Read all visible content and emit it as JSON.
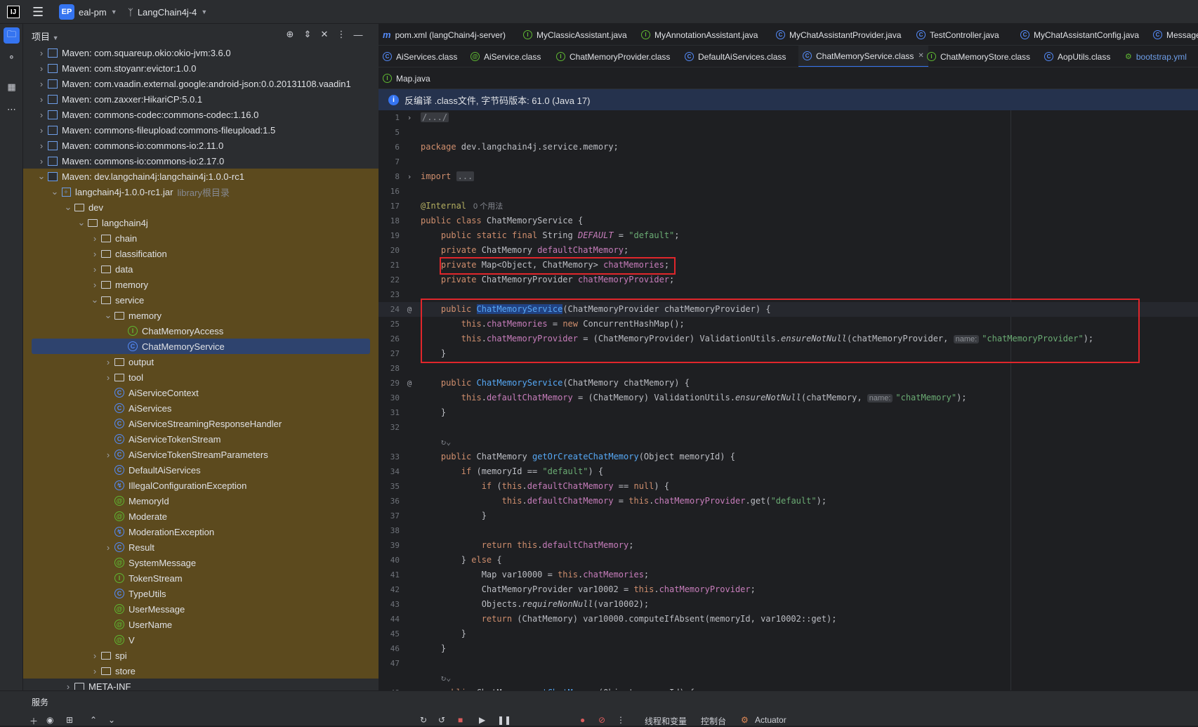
{
  "titlebar": {
    "app_logo": "IJ",
    "project_badge": "EP",
    "project_name": "eal-pm",
    "branch_name": "LangChain4j-4"
  },
  "project_panel": {
    "title": "项目",
    "rows": [
      {
        "label": "Maven: com.squareup.okio:okio-jvm:3.6.0",
        "depth": 1,
        "icon": "lib",
        "open": false
      },
      {
        "label": "Maven: com.stoyanr:evictor:1.0.0",
        "depth": 1,
        "icon": "lib",
        "open": false
      },
      {
        "label": "Maven: com.vaadin.external.google:android-json:0.0.20131108.vaadin1",
        "depth": 1,
        "icon": "lib",
        "open": false
      },
      {
        "label": "Maven: com.zaxxer:HikariCP:5.0.1",
        "depth": 1,
        "icon": "lib",
        "open": false
      },
      {
        "label": "Maven: commons-codec:commons-codec:1.16.0",
        "depth": 1,
        "icon": "lib",
        "open": false
      },
      {
        "label": "Maven: commons-fileupload:commons-fileupload:1.5",
        "depth": 1,
        "icon": "lib",
        "open": false
      },
      {
        "label": "Maven: commons-io:commons-io:2.11.0",
        "depth": 1,
        "icon": "lib",
        "open": false
      },
      {
        "label": "Maven: commons-io:commons-io:2.17.0",
        "depth": 1,
        "icon": "lib",
        "open": false
      },
      {
        "label": "Maven: dev.langchain4j:langchain4j:1.0.0-rc1",
        "depth": 1,
        "icon": "lib",
        "open": true
      },
      {
        "label": "langchain4j-1.0.0-rc1.jar",
        "extra": "library根目录",
        "depth": 2,
        "icon": "jar",
        "open": true
      },
      {
        "label": "dev",
        "depth": 3,
        "icon": "folder",
        "open": true
      },
      {
        "label": "langchain4j",
        "depth": 4,
        "icon": "folder",
        "open": true
      },
      {
        "label": "chain",
        "depth": 5,
        "icon": "folder",
        "open": false
      },
      {
        "label": "classification",
        "depth": 5,
        "icon": "folder",
        "open": false
      },
      {
        "label": "data",
        "depth": 5,
        "icon": "folder",
        "open": false
      },
      {
        "label": "memory",
        "depth": 5,
        "icon": "folder",
        "open": false
      },
      {
        "label": "service",
        "depth": 5,
        "icon": "folder",
        "open": true
      },
      {
        "label": "memory",
        "depth": 6,
        "icon": "folder",
        "open": true
      },
      {
        "label": "ChatMemoryAccess",
        "depth": 7,
        "icon": "iface"
      },
      {
        "label": "ChatMemoryService",
        "depth": 7,
        "icon": "class",
        "selected": true
      },
      {
        "label": "output",
        "depth": 6,
        "icon": "folder",
        "open": false
      },
      {
        "label": "tool",
        "depth": 6,
        "icon": "folder",
        "open": false
      },
      {
        "label": "AiServiceContext",
        "depth": 6,
        "icon": "class"
      },
      {
        "label": "AiServices",
        "depth": 6,
        "icon": "class"
      },
      {
        "label": "AiServiceStreamingResponseHandler",
        "depth": 6,
        "icon": "class"
      },
      {
        "label": "AiServiceTokenStream",
        "depth": 6,
        "icon": "class"
      },
      {
        "label": "AiServiceTokenStreamParameters",
        "depth": 6,
        "icon": "class",
        "open": false
      },
      {
        "label": "DefaultAiServices",
        "depth": 6,
        "icon": "class"
      },
      {
        "label": "IllegalConfigurationException",
        "depth": 6,
        "icon": "exc"
      },
      {
        "label": "MemoryId",
        "depth": 6,
        "icon": "anno"
      },
      {
        "label": "Moderate",
        "depth": 6,
        "icon": "anno"
      },
      {
        "label": "ModerationException",
        "depth": 6,
        "icon": "exc"
      },
      {
        "label": "Result",
        "depth": 6,
        "icon": "class",
        "open": false
      },
      {
        "label": "SystemMessage",
        "depth": 6,
        "icon": "anno"
      },
      {
        "label": "TokenStream",
        "depth": 6,
        "icon": "iface"
      },
      {
        "label": "TypeUtils",
        "depth": 6,
        "icon": "class"
      },
      {
        "label": "UserMessage",
        "depth": 6,
        "icon": "anno"
      },
      {
        "label": "UserName",
        "depth": 6,
        "icon": "anno"
      },
      {
        "label": "V",
        "depth": 6,
        "icon": "anno"
      },
      {
        "label": "spi",
        "depth": 5,
        "icon": "folder",
        "open": false
      },
      {
        "label": "store",
        "depth": 5,
        "icon": "folder",
        "open": false
      },
      {
        "label": "META-INF",
        "depth": 3,
        "icon": "folder",
        "open": false
      }
    ]
  },
  "tabs_row1": [
    {
      "label": "pom.xml (langChain4j-server)",
      "icon": "m"
    },
    {
      "label": "MyClassicAssistant.java",
      "icon": "iface"
    },
    {
      "label": "MyAnnotationAssistant.java",
      "icon": "iface"
    },
    {
      "label": "MyChatAssistantProvider.java",
      "icon": "class"
    },
    {
      "label": "TestController.java",
      "icon": "class"
    },
    {
      "label": "MyChatAssistantConfig.java",
      "icon": "class"
    },
    {
      "label": "Message",
      "icon": "class"
    }
  ],
  "tabs_row2": [
    {
      "label": "AiServices.class",
      "icon": "class"
    },
    {
      "label": "AiService.class",
      "icon": "anno"
    },
    {
      "label": "ChatMemoryProvider.class",
      "icon": "iface"
    },
    {
      "label": "DefaultAiServices.class",
      "icon": "class"
    },
    {
      "label": "ChatMemoryService.class",
      "icon": "class",
      "active": true
    },
    {
      "label": "ChatMemoryStore.class",
      "icon": "iface"
    },
    {
      "label": "AopUtils.class",
      "icon": "class"
    },
    {
      "label": "bootstrap.yml",
      "icon": "yml"
    }
  ],
  "tabs_row3": [
    {
      "label": "Map.java",
      "icon": "iface"
    }
  ],
  "infobar": {
    "text": "反编译 .class文件, 字节码版本: 61.0 (Java 17)"
  },
  "code": {
    "usages": "0 个用法",
    "hint_name": "name:"
  },
  "bottom": {
    "title": "服务",
    "tools": [
      "线程和变量",
      "控制台",
      "Actuator"
    ]
  }
}
